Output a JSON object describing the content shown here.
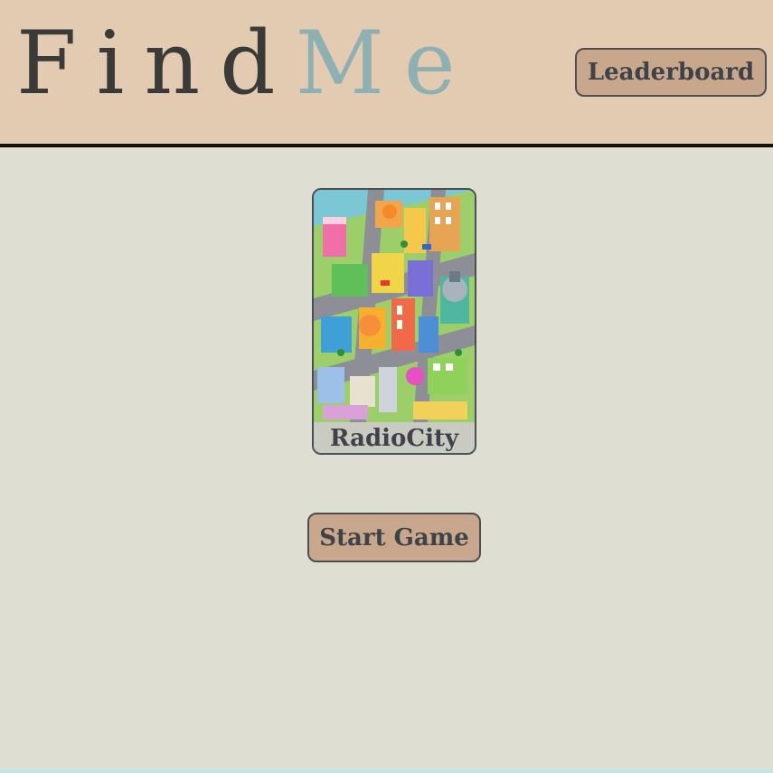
{
  "header": {
    "logo_find": "Find",
    "logo_me": "Me",
    "leaderboard_label": "Leaderboard"
  },
  "maps": [
    {
      "name": "RadioCity",
      "thumbnail_icon": "isometric-city-illustration"
    }
  ],
  "actions": {
    "start_label": "Start Game"
  },
  "colors": {
    "header_bg": "#e3cbb2",
    "page_bg": "#dedfd2",
    "button_bg": "#c8a78c",
    "text_dark": "#3e4349",
    "logo_accent": "#8fb0b3"
  }
}
